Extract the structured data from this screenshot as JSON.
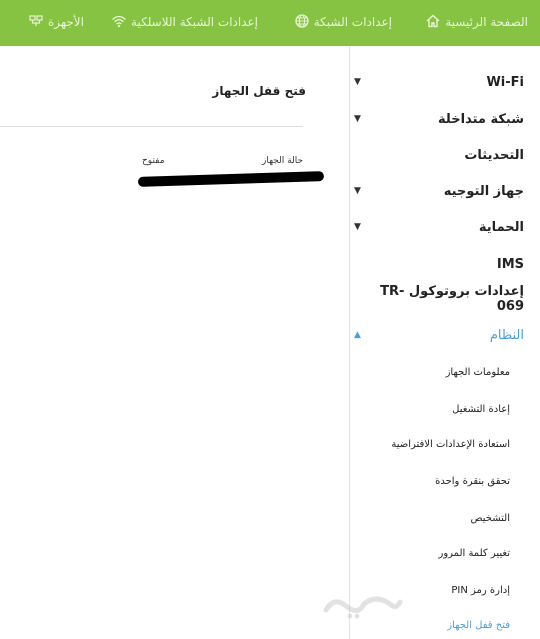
{
  "topnav": {
    "items": [
      {
        "label": "الصفحة الرئيسية",
        "icon": "home-icon"
      },
      {
        "label": "إعدادات الشبكة",
        "icon": "globe-icon"
      },
      {
        "label": "إعدادات الشبكة اللاسلكية",
        "icon": "wifi-icon"
      },
      {
        "label": "الأجهزة",
        "icon": "devices-icon"
      }
    ]
  },
  "sidebar": {
    "items": [
      {
        "label": "Wi-Fi"
      },
      {
        "label": "شبكة متداخلة"
      },
      {
        "label": "التحديثات"
      },
      {
        "label": "جهاز التوجيه"
      },
      {
        "label": "الحماية"
      },
      {
        "label": "IMS"
      },
      {
        "label": "إعدادات بروتوكول TR-069"
      },
      {
        "label": "النظام"
      }
    ],
    "submenu": [
      {
        "label": "معلومات الجهاز"
      },
      {
        "label": "إعادة التشغيل"
      },
      {
        "label": "استعادة الإعدادات الافتراضية"
      },
      {
        "label": "تحقق بنقرة واحدة"
      },
      {
        "label": "التشخيص"
      },
      {
        "label": "تغيير كلمة المرور"
      },
      {
        "label": "إدارة رمز PIN"
      },
      {
        "label": "فتح قفل الجهاز"
      }
    ]
  },
  "main": {
    "title": "فتح قفل الجهاز",
    "status_label": "حالة الجهاز",
    "status_value": "مفتوح"
  },
  "colors": {
    "topbar": "#86c342",
    "accent": "#4a9fd8"
  }
}
